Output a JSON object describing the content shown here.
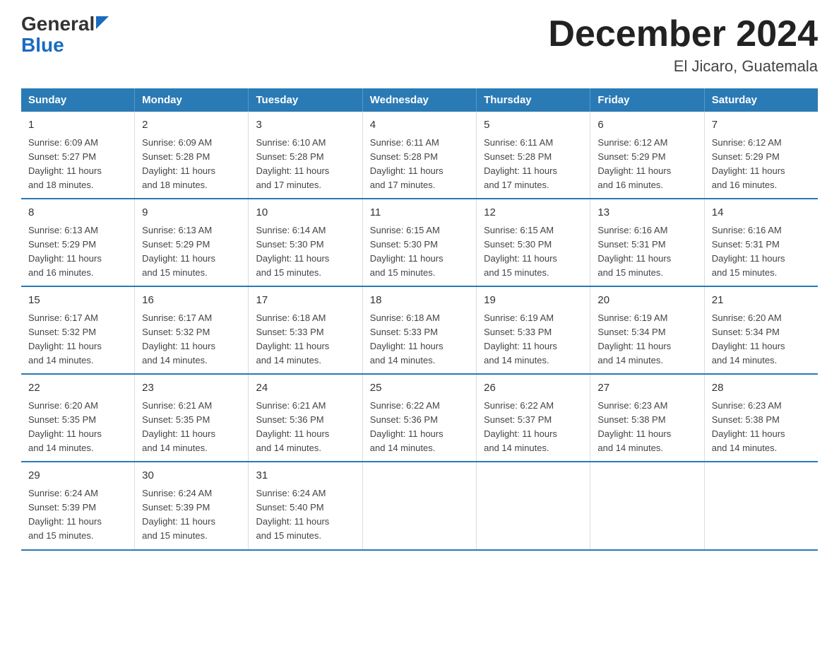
{
  "header": {
    "logo_general": "General",
    "logo_blue": "Blue",
    "title": "December 2024",
    "subtitle": "El Jicaro, Guatemala"
  },
  "days_of_week": [
    "Sunday",
    "Monday",
    "Tuesday",
    "Wednesday",
    "Thursday",
    "Friday",
    "Saturday"
  ],
  "weeks": [
    [
      {
        "day": "1",
        "sunrise": "6:09 AM",
        "sunset": "5:27 PM",
        "daylight": "11 hours and 18 minutes."
      },
      {
        "day": "2",
        "sunrise": "6:09 AM",
        "sunset": "5:28 PM",
        "daylight": "11 hours and 18 minutes."
      },
      {
        "day": "3",
        "sunrise": "6:10 AM",
        "sunset": "5:28 PM",
        "daylight": "11 hours and 17 minutes."
      },
      {
        "day": "4",
        "sunrise": "6:11 AM",
        "sunset": "5:28 PM",
        "daylight": "11 hours and 17 minutes."
      },
      {
        "day": "5",
        "sunrise": "6:11 AM",
        "sunset": "5:28 PM",
        "daylight": "11 hours and 17 minutes."
      },
      {
        "day": "6",
        "sunrise": "6:12 AM",
        "sunset": "5:29 PM",
        "daylight": "11 hours and 16 minutes."
      },
      {
        "day": "7",
        "sunrise": "6:12 AM",
        "sunset": "5:29 PM",
        "daylight": "11 hours and 16 minutes."
      }
    ],
    [
      {
        "day": "8",
        "sunrise": "6:13 AM",
        "sunset": "5:29 PM",
        "daylight": "11 hours and 16 minutes."
      },
      {
        "day": "9",
        "sunrise": "6:13 AM",
        "sunset": "5:29 PM",
        "daylight": "11 hours and 15 minutes."
      },
      {
        "day": "10",
        "sunrise": "6:14 AM",
        "sunset": "5:30 PM",
        "daylight": "11 hours and 15 minutes."
      },
      {
        "day": "11",
        "sunrise": "6:15 AM",
        "sunset": "5:30 PM",
        "daylight": "11 hours and 15 minutes."
      },
      {
        "day": "12",
        "sunrise": "6:15 AM",
        "sunset": "5:30 PM",
        "daylight": "11 hours and 15 minutes."
      },
      {
        "day": "13",
        "sunrise": "6:16 AM",
        "sunset": "5:31 PM",
        "daylight": "11 hours and 15 minutes."
      },
      {
        "day": "14",
        "sunrise": "6:16 AM",
        "sunset": "5:31 PM",
        "daylight": "11 hours and 15 minutes."
      }
    ],
    [
      {
        "day": "15",
        "sunrise": "6:17 AM",
        "sunset": "5:32 PM",
        "daylight": "11 hours and 14 minutes."
      },
      {
        "day": "16",
        "sunrise": "6:17 AM",
        "sunset": "5:32 PM",
        "daylight": "11 hours and 14 minutes."
      },
      {
        "day": "17",
        "sunrise": "6:18 AM",
        "sunset": "5:33 PM",
        "daylight": "11 hours and 14 minutes."
      },
      {
        "day": "18",
        "sunrise": "6:18 AM",
        "sunset": "5:33 PM",
        "daylight": "11 hours and 14 minutes."
      },
      {
        "day": "19",
        "sunrise": "6:19 AM",
        "sunset": "5:33 PM",
        "daylight": "11 hours and 14 minutes."
      },
      {
        "day": "20",
        "sunrise": "6:19 AM",
        "sunset": "5:34 PM",
        "daylight": "11 hours and 14 minutes."
      },
      {
        "day": "21",
        "sunrise": "6:20 AM",
        "sunset": "5:34 PM",
        "daylight": "11 hours and 14 minutes."
      }
    ],
    [
      {
        "day": "22",
        "sunrise": "6:20 AM",
        "sunset": "5:35 PM",
        "daylight": "11 hours and 14 minutes."
      },
      {
        "day": "23",
        "sunrise": "6:21 AM",
        "sunset": "5:35 PM",
        "daylight": "11 hours and 14 minutes."
      },
      {
        "day": "24",
        "sunrise": "6:21 AM",
        "sunset": "5:36 PM",
        "daylight": "11 hours and 14 minutes."
      },
      {
        "day": "25",
        "sunrise": "6:22 AM",
        "sunset": "5:36 PM",
        "daylight": "11 hours and 14 minutes."
      },
      {
        "day": "26",
        "sunrise": "6:22 AM",
        "sunset": "5:37 PM",
        "daylight": "11 hours and 14 minutes."
      },
      {
        "day": "27",
        "sunrise": "6:23 AM",
        "sunset": "5:38 PM",
        "daylight": "11 hours and 14 minutes."
      },
      {
        "day": "28",
        "sunrise": "6:23 AM",
        "sunset": "5:38 PM",
        "daylight": "11 hours and 14 minutes."
      }
    ],
    [
      {
        "day": "29",
        "sunrise": "6:24 AM",
        "sunset": "5:39 PM",
        "daylight": "11 hours and 15 minutes."
      },
      {
        "day": "30",
        "sunrise": "6:24 AM",
        "sunset": "5:39 PM",
        "daylight": "11 hours and 15 minutes."
      },
      {
        "day": "31",
        "sunrise": "6:24 AM",
        "sunset": "5:40 PM",
        "daylight": "11 hours and 15 minutes."
      },
      null,
      null,
      null,
      null
    ]
  ]
}
